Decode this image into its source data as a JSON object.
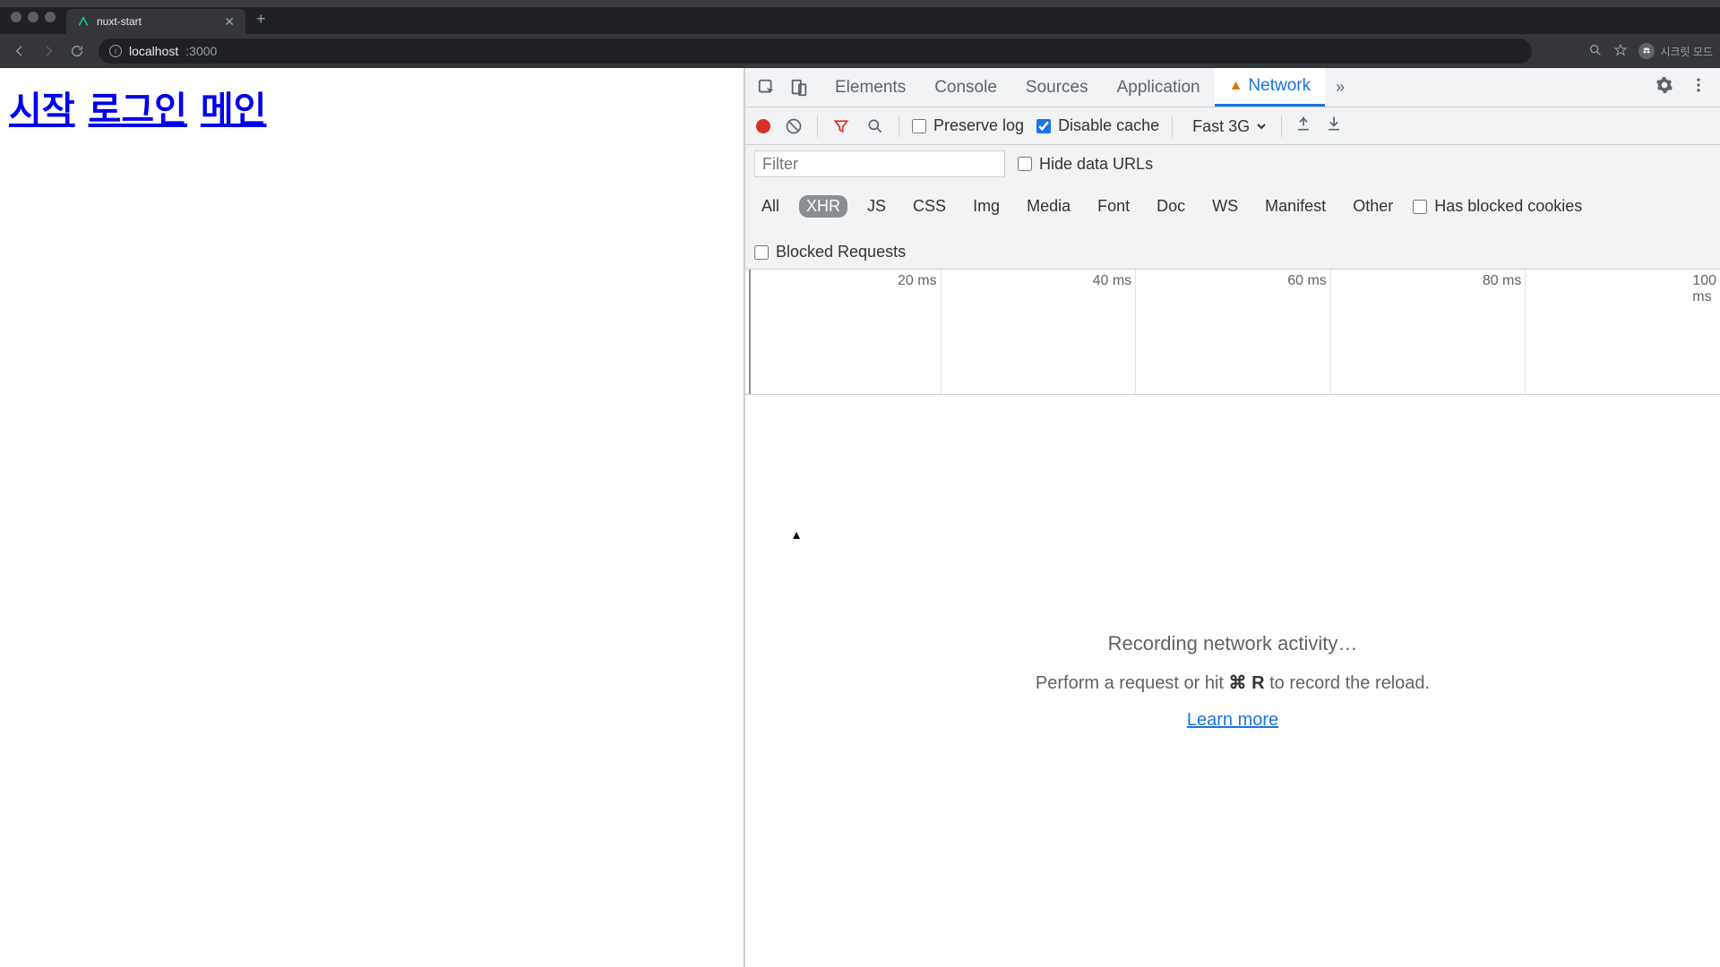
{
  "browser": {
    "tab_title": "nuxt-start",
    "url_host": "localhost",
    "url_port": ":3000",
    "incognito_label": "시크릿 모드"
  },
  "page": {
    "links": [
      "시작",
      "로그인",
      "메인"
    ]
  },
  "devtools": {
    "tabs": [
      "Elements",
      "Console",
      "Sources",
      "Application",
      "Network"
    ],
    "active_tab": "Network",
    "toolbar": {
      "preserve_log": "Preserve log",
      "disable_cache": "Disable cache",
      "throttling": "Fast 3G"
    },
    "filter": {
      "placeholder": "Filter",
      "hide_data_urls": "Hide data URLs",
      "types": [
        "All",
        "XHR",
        "JS",
        "CSS",
        "Img",
        "Media",
        "Font",
        "Doc",
        "WS",
        "Manifest",
        "Other"
      ],
      "selected_type": "XHR",
      "has_blocked_cookies": "Has blocked cookies",
      "blocked_requests": "Blocked Requests"
    },
    "timeline": {
      "ticks": [
        "20 ms",
        "40 ms",
        "60 ms",
        "80 ms",
        "100 ms"
      ]
    },
    "empty": {
      "title": "Recording network activity…",
      "subtitle_pre": "Perform a request or hit ",
      "subtitle_kbd": "⌘ R",
      "subtitle_post": " to record the reload.",
      "learn_more": "Learn more"
    }
  }
}
